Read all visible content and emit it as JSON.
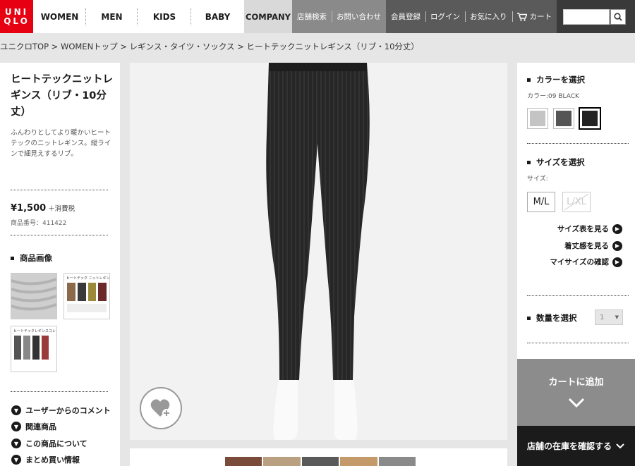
{
  "header": {
    "logo_lines": [
      "UNI",
      "QLO"
    ],
    "nav": [
      "WOMEN",
      "MEN",
      "KIDS",
      "BABY"
    ],
    "company": "COMPANY",
    "util1": [
      "店舗検索",
      "お問い合わせ"
    ],
    "util2": [
      "会員登録",
      "ログイン",
      "お気に入り"
    ],
    "cart": "カート",
    "search_placeholder": ""
  },
  "breadcrumb": "ユニクロTOP > WOMENトップ > レギンス・タイツ・ソックス > ヒートテックニットレギンス（リブ・10分丈）",
  "product": {
    "title": "ヒートテックニットレギンス（リブ・10分丈）",
    "description": "ふんわりとしてより暖かいヒートテックのニットレギンス。縦ラインで細見えするリブ。",
    "price": "¥1,500",
    "tax": "＋消費税",
    "number": "商品番号：411422",
    "images_heading": "商品画像",
    "thumb2_text": "ヒートテック ニットレギンス",
    "thumb3_text": "ヒートテックレギンスコレクション"
  },
  "accordion": [
    "ユーザーからのコメント",
    "関連商品",
    "この商品について",
    "まとめ買い情報"
  ],
  "options": {
    "color_heading": "カラーを選択",
    "color_label": "カラー:09 BLACK",
    "colors": [
      "#c4c4c4",
      "#555555",
      "#222222"
    ],
    "selected_color_index": 2,
    "size_heading": "サイズを選択",
    "size_label": "サイズ:",
    "sizes": [
      "M/L",
      "L/XL"
    ],
    "size_links": [
      "サイズ表を見る",
      "着丈感を見る",
      "マイサイズの確認"
    ],
    "qty_heading": "数量を選択",
    "qty_value": "1"
  },
  "actions": {
    "add_to_cart": "カートに追加",
    "store_stock": "店舗の在庫を確認する"
  },
  "colors": {
    "brand_red": "#e60012",
    "cart_bg": "#8c8c8c",
    "stock_bg": "#1b1b1b"
  }
}
